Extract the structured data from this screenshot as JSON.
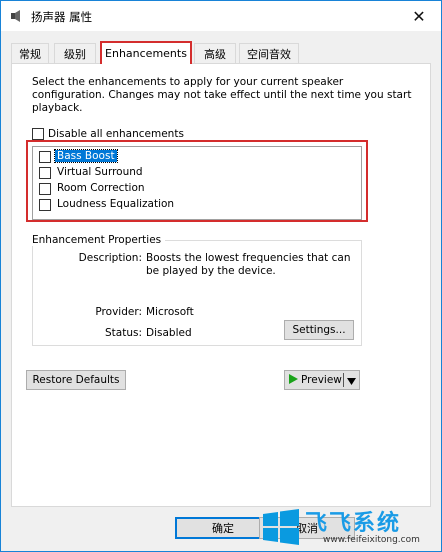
{
  "window": {
    "title": "扬声器 属性"
  },
  "tabs": [
    {
      "label": "常规"
    },
    {
      "label": "级别"
    },
    {
      "label": "Enhancements"
    },
    {
      "label": "高级"
    },
    {
      "label": "空间音效"
    }
  ],
  "enhancements": {
    "description": "Select the enhancements to apply for your current speaker configuration. Changes may not take effect until the next time you start playback.",
    "disable_all_label": "Disable all enhancements",
    "items": [
      {
        "label": "Bass Boost",
        "checked": false,
        "selected": true
      },
      {
        "label": "Virtual Surround",
        "checked": false
      },
      {
        "label": "Room Correction",
        "checked": false
      },
      {
        "label": "Loudness Equalization",
        "checked": false
      }
    ]
  },
  "properties": {
    "group_title": "Enhancement Properties",
    "description_label": "Description:",
    "description_value": "Boosts the lowest frequencies that can be played by the device.",
    "provider_label": "Provider:",
    "provider_value": "Microsoft",
    "status_label": "Status:",
    "status_value": "Disabled",
    "settings_button": "Settings..."
  },
  "actions": {
    "restore_defaults": "Restore Defaults",
    "preview": "Preview"
  },
  "footer": {
    "ok": "确定",
    "cancel": "取消"
  },
  "watermark": {
    "brand": "飞飞系统",
    "url": "www.feifeixitong.com"
  },
  "colors": {
    "accent": "#0078d7",
    "highlight_box": "#d42d2d",
    "preview_arrow": "#1aa31a"
  }
}
